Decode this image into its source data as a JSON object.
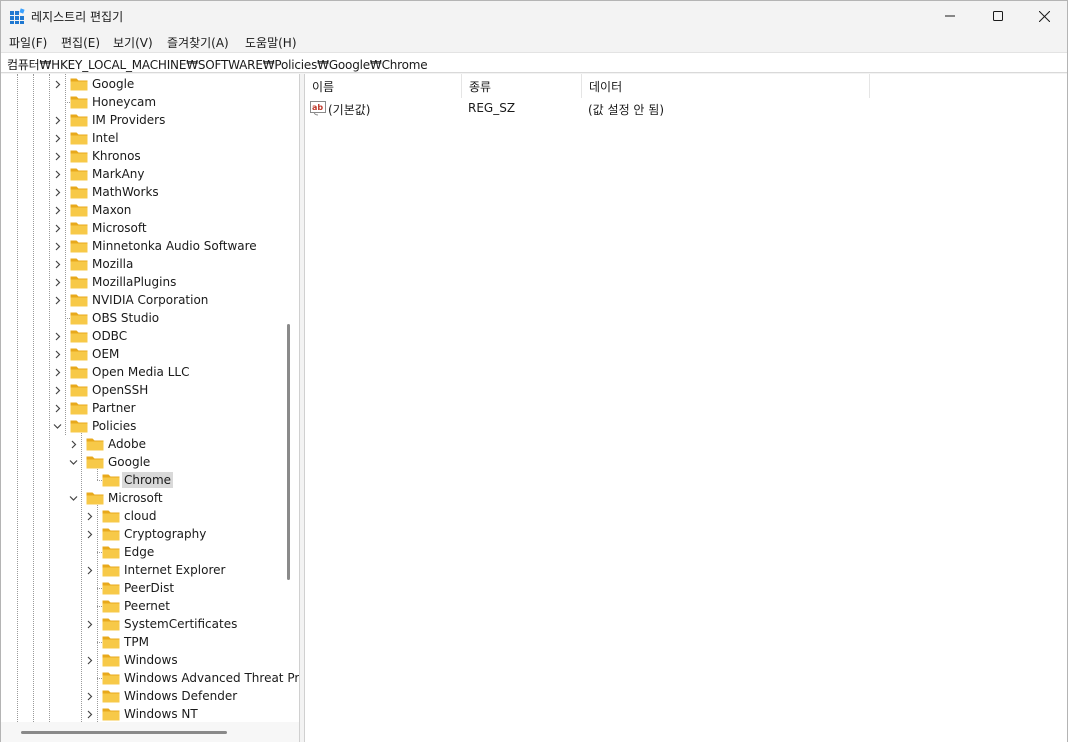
{
  "window": {
    "title": "레지스트리 편집기",
    "minimize_label": "Minimize",
    "maximize_label": "Maximize",
    "close_label": "Close"
  },
  "menu": [
    "파일(F)",
    "편집(E)",
    "보기(V)",
    "즐겨찾기(A)",
    "도움말(H)"
  ],
  "address": "컴퓨터₩HKEY_LOCAL_MACHINE₩SOFTWARE₩Policies₩Google₩Chrome",
  "tree": {
    "level1": [
      {
        "label": "Google",
        "expandable": true
      },
      {
        "label": "Honeycam",
        "expandable": false
      },
      {
        "label": "IM Providers",
        "expandable": true
      },
      {
        "label": "Intel",
        "expandable": true
      },
      {
        "label": "Khronos",
        "expandable": true
      },
      {
        "label": "MarkAny",
        "expandable": true
      },
      {
        "label": "MathWorks",
        "expandable": true
      },
      {
        "label": "Maxon",
        "expandable": true
      },
      {
        "label": "Microsoft",
        "expandable": true
      },
      {
        "label": "Minnetonka Audio Software",
        "expandable": true
      },
      {
        "label": "Mozilla",
        "expandable": true
      },
      {
        "label": "MozillaPlugins",
        "expandable": true
      },
      {
        "label": "NVIDIA Corporation",
        "expandable": true
      },
      {
        "label": "OBS Studio",
        "expandable": false
      },
      {
        "label": "ODBC",
        "expandable": true
      },
      {
        "label": "OEM",
        "expandable": true
      },
      {
        "label": "Open Media LLC",
        "expandable": true
      },
      {
        "label": "OpenSSH",
        "expandable": true
      },
      {
        "label": "Partner",
        "expandable": true
      },
      {
        "label": "Policies",
        "expandable": true,
        "expanded": true
      }
    ],
    "policies_children": [
      {
        "label": "Adobe",
        "expandable": true
      },
      {
        "label": "Google",
        "expandable": true,
        "expanded": true
      },
      {
        "label": "Microsoft",
        "expandable": true,
        "expanded": true
      }
    ],
    "google_children": [
      {
        "label": "Chrome",
        "selected": true
      }
    ],
    "microsoft_children": [
      {
        "label": "cloud",
        "expandable": true
      },
      {
        "label": "Cryptography",
        "expandable": true
      },
      {
        "label": "Edge",
        "expandable": false
      },
      {
        "label": "Internet Explorer",
        "expandable": true
      },
      {
        "label": "PeerDist",
        "expandable": false
      },
      {
        "label": "Peernet",
        "expandable": false
      },
      {
        "label": "SystemCertificates",
        "expandable": true
      },
      {
        "label": "TPM",
        "expandable": false
      },
      {
        "label": "Windows",
        "expandable": true
      },
      {
        "label": "Windows Advanced Threat Pr",
        "expandable": false
      },
      {
        "label": "Windows Defender",
        "expandable": true
      },
      {
        "label": "Windows NT",
        "expandable": true
      }
    ]
  },
  "list": {
    "columns": [
      "이름",
      "종류",
      "데이터"
    ],
    "rows": [
      {
        "icon": "string-value-icon",
        "name": "(기본값)",
        "type": "REG_SZ",
        "data": "(값 설정 안 됨)"
      }
    ]
  },
  "colors": {
    "folder": "#f7c948",
    "folder_dark": "#e8a91c",
    "selected_bg": "#d9d9d9",
    "string_icon": "#c0392b"
  }
}
